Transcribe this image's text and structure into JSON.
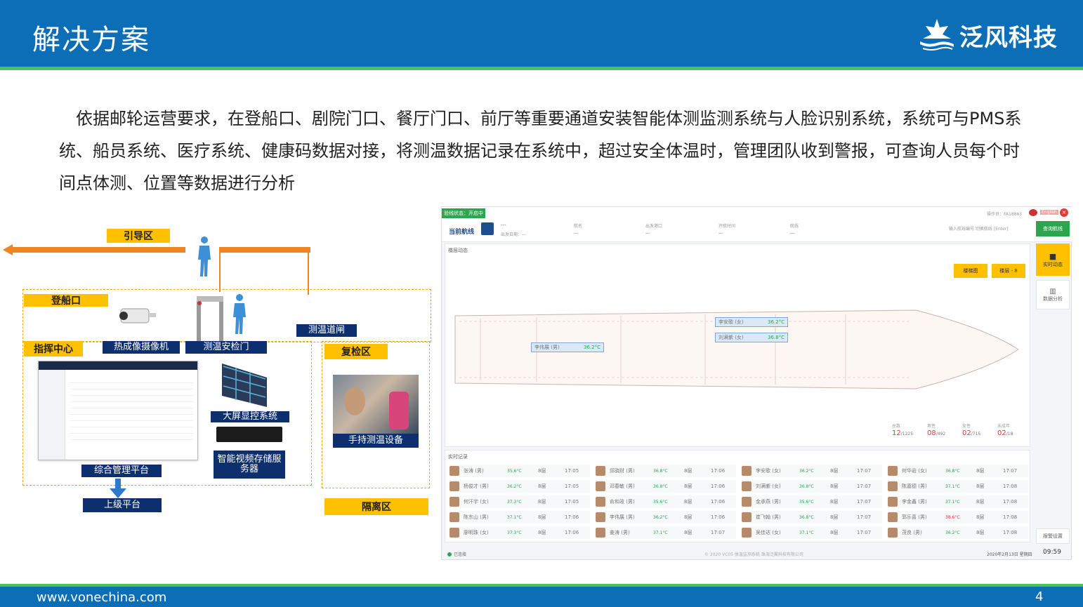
{
  "header": {
    "title": "解决方案",
    "logo_text": "泛风科技"
  },
  "intro": "依据邮轮运营要求，在登船口、剧院门口、餐厅门口、前厅等重要通道安装智能体测监测系统与人脸识别系统，系统可与PMS系统、船员系统、医疗系统、健康码数据对接，将测温数据记录在系统中，超过安全体温时，管理团队收到警报，可查询人员每个时间点体测、位置等数据进行分析",
  "diagram": {
    "guide_area": "引导区",
    "boarding": "登船口",
    "command_center": "指挥中心",
    "thermal_camera": "热成像摄像机",
    "security_gate": "测温安检门",
    "temp_channel": "测温道闸",
    "recheck_area": "复检区",
    "big_screen": "大屏显控系统",
    "handheld": "手持测温设备",
    "video_storage": "智能视频存储服务器",
    "mgmt_platform": "综合管理平台",
    "upper_platform": "上级平台",
    "isolation": "隔离区"
  },
  "app": {
    "status_chip": "验线状态：开启中",
    "current_route_label": "当前航线",
    "route_value": "---",
    "depart_date": "出发日期：---",
    "cols": [
      {
        "label": "航名",
        "value": "---"
      },
      {
        "label": "出发港口",
        "value": "---"
      },
      {
        "label": "开航时间",
        "value": "---"
      },
      {
        "label": "航线",
        "value": "---"
      }
    ],
    "operator": "操作员：FA18863",
    "lang": "English",
    "search_placeholder": "输入航线编号 切换航线 [Enter]",
    "search_button": "查询航线",
    "deck_title": "楼层动态",
    "btn_deck_plan": "楼梯图",
    "btn_floor": "楼层 - 8",
    "side_realtime": "实时动态",
    "side_data": "数据分析",
    "side_alarm": "报警设置",
    "ship_tags": [
      {
        "name": "李伟展 (男)",
        "temp": "36.2°C"
      },
      {
        "name": "李安歌 (女)",
        "temp": "36.2°C"
      },
      {
        "name": "刘满紫 (女)",
        "temp": "36.8°C"
      }
    ],
    "stats": [
      {
        "label": "总数",
        "value": "12",
        "total": "/1225"
      },
      {
        "label": "男性",
        "value": "08",
        "total": "/492"
      },
      {
        "label": "女性",
        "value": "02",
        "total": "/715"
      },
      {
        "label": "未成年",
        "value": "02",
        "total": "/18"
      }
    ],
    "records_title": "实时记录",
    "records": [
      [
        [
          "张涛 (男)",
          "35.6°C",
          "8层",
          "17:05"
        ],
        [
          "邱骁财 (男)",
          "36.8°C",
          "8层",
          "17:06"
        ],
        [
          "李安歌 (女)",
          "36.2°C",
          "8层",
          "17:07"
        ],
        [
          "何华岩 (女)",
          "36.8°C",
          "8层",
          "17:07"
        ]
      ],
      [
        [
          "杨俊才 (男)",
          "36.2°C",
          "8层",
          "17:05"
        ],
        [
          "邓春敏 (男)",
          "36.8°C",
          "8层",
          "17:06"
        ],
        [
          "刘满紫 (女)",
          "36.8°C",
          "8层",
          "17:07"
        ],
        [
          "陈嘉德 (男)",
          "37.1°C",
          "8层",
          "17:08"
        ]
      ],
      [
        [
          "何汗宇 (女)",
          "37.3°C",
          "8层",
          "17:05"
        ],
        [
          "俞和政 (男)",
          "35.6°C",
          "8层",
          "17:06"
        ],
        [
          "金承燕 (男)",
          "35.6°C",
          "8层",
          "17:07"
        ],
        [
          "李金鑫 (男)",
          "37.1°C",
          "8层",
          "17:08"
        ]
      ],
      [
        [
          "陈东山 (男)",
          "37.1°C",
          "8层",
          "17:06"
        ],
        [
          "李伟展 (男)",
          "36.2°C",
          "8层",
          "17:06"
        ],
        [
          "崔飞翰 (男)",
          "36.8°C",
          "8层",
          "17:07"
        ],
        [
          "郭乐喜 (男)",
          "38.6°C",
          "8层",
          "17:08"
        ]
      ],
      [
        [
          "廖明珠 (女)",
          "37.3°C",
          "8层",
          "17:06"
        ],
        [
          "姜涛 (男)",
          "37.1°C",
          "8层",
          "17:07"
        ],
        [
          "吴佳达 (女)",
          "37.1°C",
          "8层",
          "17:07"
        ],
        [
          "茂良 (男)",
          "36.2°C",
          "8层",
          "17:08"
        ]
      ]
    ],
    "footer_status": "已连接",
    "copyright": "© 2020 VC05 体温监测系统  珠海泛翼科技有限公司",
    "date": "2020年2月13日 星期四",
    "time": "09:59"
  },
  "footer": {
    "url": "www.vonechina.com",
    "page": "4"
  },
  "colors": {
    "header_blue": "#0d6eb8",
    "accent_green": "#4bc25a",
    "tag_yellow": "#ffc000",
    "navy": "#0e2f6e",
    "alert_red": "#e53935"
  }
}
